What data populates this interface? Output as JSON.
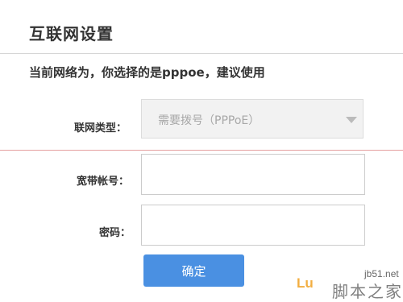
{
  "page": {
    "title": "互联网设置",
    "notice": "当前网络为，你选择的是pppoe，建议使用"
  },
  "form": {
    "connection_type": {
      "label": "联网类型：",
      "selected": "需要拨号（PPPoE）"
    },
    "account": {
      "label": "宽带帐号：",
      "value": ""
    },
    "password": {
      "label": "密码：",
      "value": ""
    },
    "confirm_label": "确定"
  },
  "watermark": {
    "site": "jb51.net",
    "logo": "Lu",
    "cn": "脚本之家"
  },
  "colors": {
    "button": "#4a90e2",
    "divider_red": "#e4a0a0",
    "watermark_logo": "#f0a020"
  },
  "icons": {
    "select_arrow": "chevron-down-icon"
  }
}
